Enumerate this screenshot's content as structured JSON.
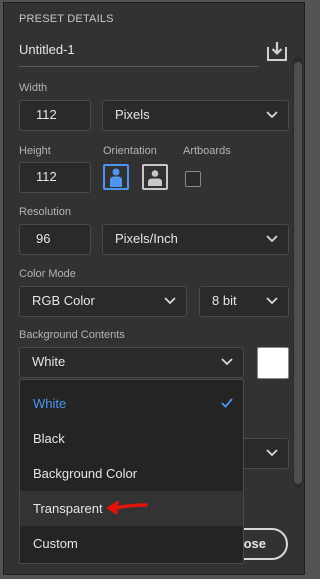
{
  "preset": {
    "section_title": "PRESET DETAILS",
    "name": "Untitled-1"
  },
  "width": {
    "label": "Width",
    "value": "112",
    "unit": "Pixels"
  },
  "height": {
    "label": "Height",
    "value": "112"
  },
  "orientation": {
    "label": "Orientation",
    "selected": "portrait"
  },
  "artboards": {
    "label": "Artboards",
    "checked": false
  },
  "resolution": {
    "label": "Resolution",
    "value": "96",
    "unit": "Pixels/Inch"
  },
  "color_mode": {
    "label": "Color Mode",
    "mode": "RGB Color",
    "depth": "8 bit"
  },
  "background": {
    "label": "Background Contents",
    "selected": "White",
    "swatch_color": "#ffffff",
    "options": [
      "White",
      "Black",
      "Background Color",
      "Transparent",
      "Custom"
    ]
  },
  "footer": {
    "close_label": "Close",
    "close_visible_text": "lose"
  },
  "colors": {
    "accent": "#4f95f0",
    "annotation_arrow": "#e3120b",
    "panel": "#323232"
  }
}
